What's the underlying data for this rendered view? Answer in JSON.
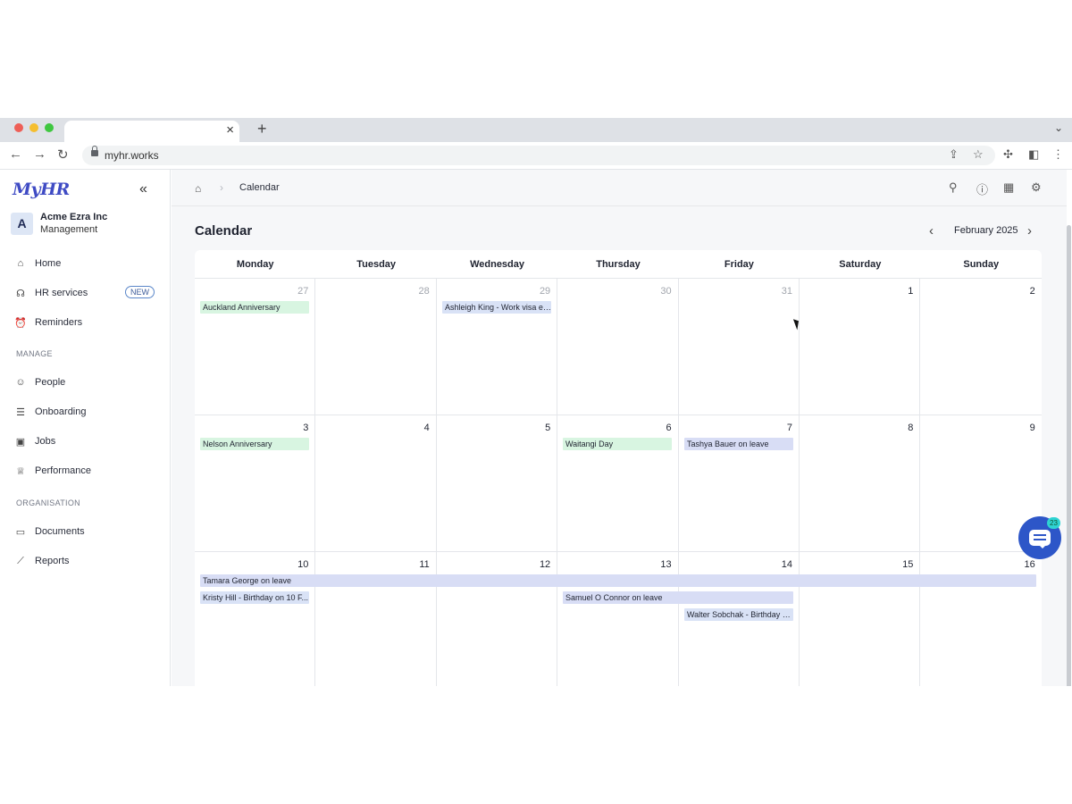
{
  "browser": {
    "url": "myhr.works",
    "traffic_colors": [
      "#ee5f57",
      "#f5be2f",
      "#3fc740"
    ]
  },
  "app": {
    "logo": "MyHR",
    "org": {
      "initial": "A",
      "name": "Acme Ezra Inc",
      "subtitle": "Management"
    },
    "nav": {
      "home": "Home",
      "hr_services": "HR services",
      "hr_services_badge": "NEW",
      "reminders": "Reminders",
      "manage_label": "MANAGE",
      "people": "People",
      "onboarding": "Onboarding",
      "jobs": "Jobs",
      "performance": "Performance",
      "organisation_label": "ORGANISATION",
      "documents": "Documents",
      "reports": "Reports"
    }
  },
  "header": {
    "breadcrumb": "Calendar"
  },
  "calendar": {
    "title": "Calendar",
    "month": "February 2025",
    "weekdays": [
      "Monday",
      "Tuesday",
      "Wednesday",
      "Thursday",
      "Friday",
      "Saturday",
      "Sunday"
    ],
    "weeks": [
      {
        "days": [
          "27",
          "28",
          "29",
          "30",
          "31",
          "1",
          "2"
        ]
      },
      {
        "days": [
          "3",
          "4",
          "5",
          "6",
          "7",
          "8",
          "9"
        ]
      },
      {
        "days": [
          "10",
          "11",
          "12",
          "13",
          "14",
          "15",
          "16"
        ]
      }
    ],
    "events": {
      "auckland": "Auckland Anniversary",
      "ashleigh": "Ashleigh King - Work visa ex...",
      "nelson": "Nelson Anniversary",
      "waitangi": "Waitangi Day",
      "tashya": "Tashya Bauer on leave",
      "tamara": "Tamara George on leave",
      "kristy": "Kristy Hill - Birthday on 10 F...",
      "samuel": "Samuel O Connor on leave",
      "walter": "Walter Sobchak - Birthday o..."
    },
    "event_colors": {
      "holiday": "#d8f5e1",
      "leave": "#d8ddf5"
    }
  },
  "chat": {
    "unread": "23"
  }
}
